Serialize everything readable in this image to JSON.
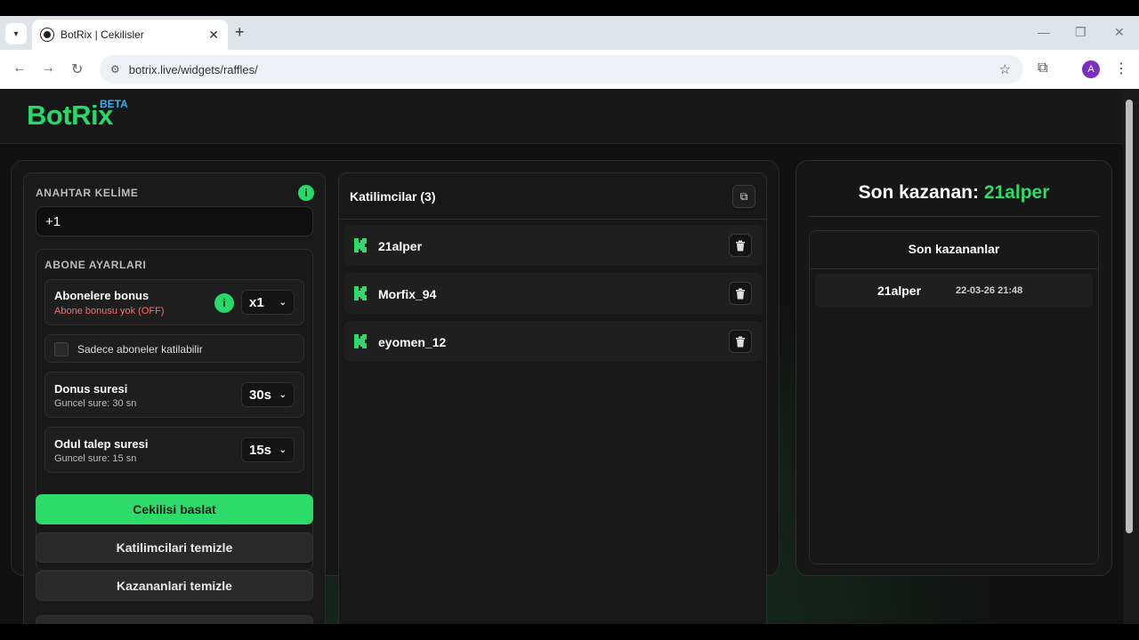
{
  "browser": {
    "tab_title": "BotRix | Cekilisler",
    "url": "botrix.live/widgets/raffles/",
    "new_tab": "+",
    "close_tab": "✕",
    "avatar_letter": "A"
  },
  "header": {
    "logo": "BotRix",
    "badge": "BETA"
  },
  "settings": {
    "keyword_label": "ANAHTAR KELİME",
    "keyword_value": "+1",
    "subscriber_settings_label": "ABONE AYARLARI",
    "sub_bonus_title": "Abonelere bonus",
    "sub_bonus_status": "Abone bonusu yok (OFF)",
    "sub_bonus_value": "x1",
    "subs_only_label": "Sadece aboneler katilabilir",
    "spin_title": "Donus suresi",
    "spin_sub": "Guncel sure: 30 sn",
    "spin_value": "30s",
    "claim_title": "Odul talep suresi",
    "claim_sub": "Guncel sure: 15 sn",
    "claim_value": "15s",
    "info_glyph": "i",
    "chevron": "⌄"
  },
  "buttons": {
    "start": "Cekilisi baslat",
    "clear_participants": "Katilimcilari temizle",
    "clear_winners": "Kazananlari temizle"
  },
  "participants": {
    "title": "Katilimcilar (3)",
    "list": [
      {
        "name": "21alper"
      },
      {
        "name": "Morfix_94"
      },
      {
        "name": "eyomen_12"
      }
    ]
  },
  "winners": {
    "last_winner_label": "Son kazanan:",
    "last_winner_name": "21alper",
    "recent_title": "Son kazananlar",
    "list": [
      {
        "name": "21alper",
        "time": "22-03-26 21:48"
      }
    ]
  },
  "colors": {
    "accent": "#2ddb6b",
    "beta": "#3ab0f0",
    "background": "#121212"
  }
}
